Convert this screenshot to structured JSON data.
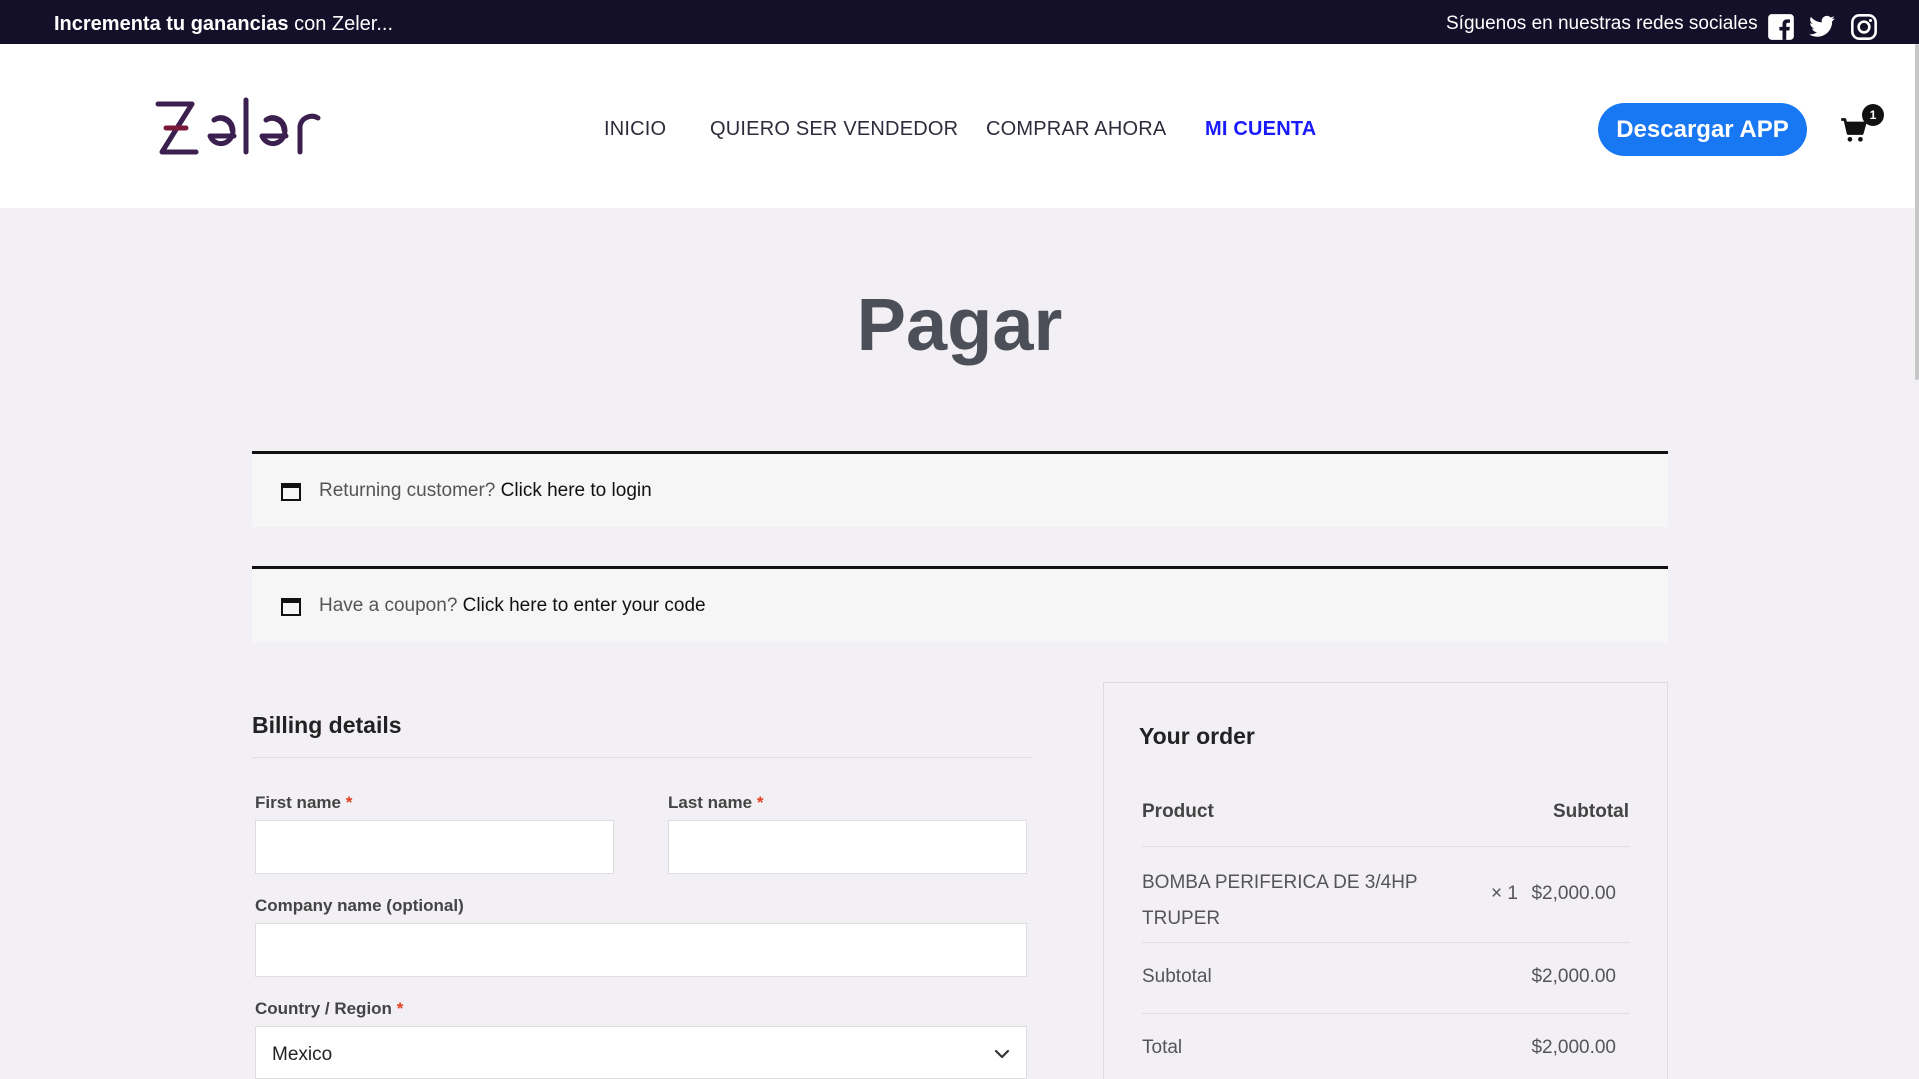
{
  "topbar": {
    "promo_bold": "Incrementa tu ganancias",
    "promo_rest": " con Zeler...",
    "social_text": "Síguenos en nuestras redes sociales"
  },
  "header": {
    "logo_alt": "Zeler",
    "nav": [
      "INICIO",
      "QUIERO SER VENDEDOR",
      "COMPRAR AHORA",
      "MI CUENTA"
    ],
    "download_label": "Descargar APP",
    "cart_count": "1"
  },
  "page": {
    "title": "Pagar"
  },
  "notices": {
    "login_text": "Returning customer?",
    "login_link": "Click here to login",
    "coupon_text": "Have a coupon?",
    "coupon_link": "Click here to enter your code"
  },
  "billing": {
    "title": "Billing details",
    "first_name_label": "First name",
    "last_name_label": "Last name",
    "company_label": "Company name (optional)",
    "country_label": "Country / Region",
    "required_mark": "*",
    "country_value": "Mexico"
  },
  "order": {
    "title": "Your order",
    "col_product": "Product",
    "col_subtotal": "Subtotal",
    "item_name_line1": "BOMBA PERIFERICA DE 3/4HP",
    "item_name_line2": "TRUPER",
    "item_qty": "× 1",
    "item_price": "$2,000.00",
    "subtotal_label": "Subtotal",
    "subtotal_value": "$2,000.00",
    "total_label": "Total",
    "total_value": "$2,000.00"
  },
  "colors": {
    "topbar_bg": "#14102a",
    "accent_button": "#1877f2",
    "active_nav": "#1a1aff",
    "brand_logo": "#3a1f4f"
  }
}
